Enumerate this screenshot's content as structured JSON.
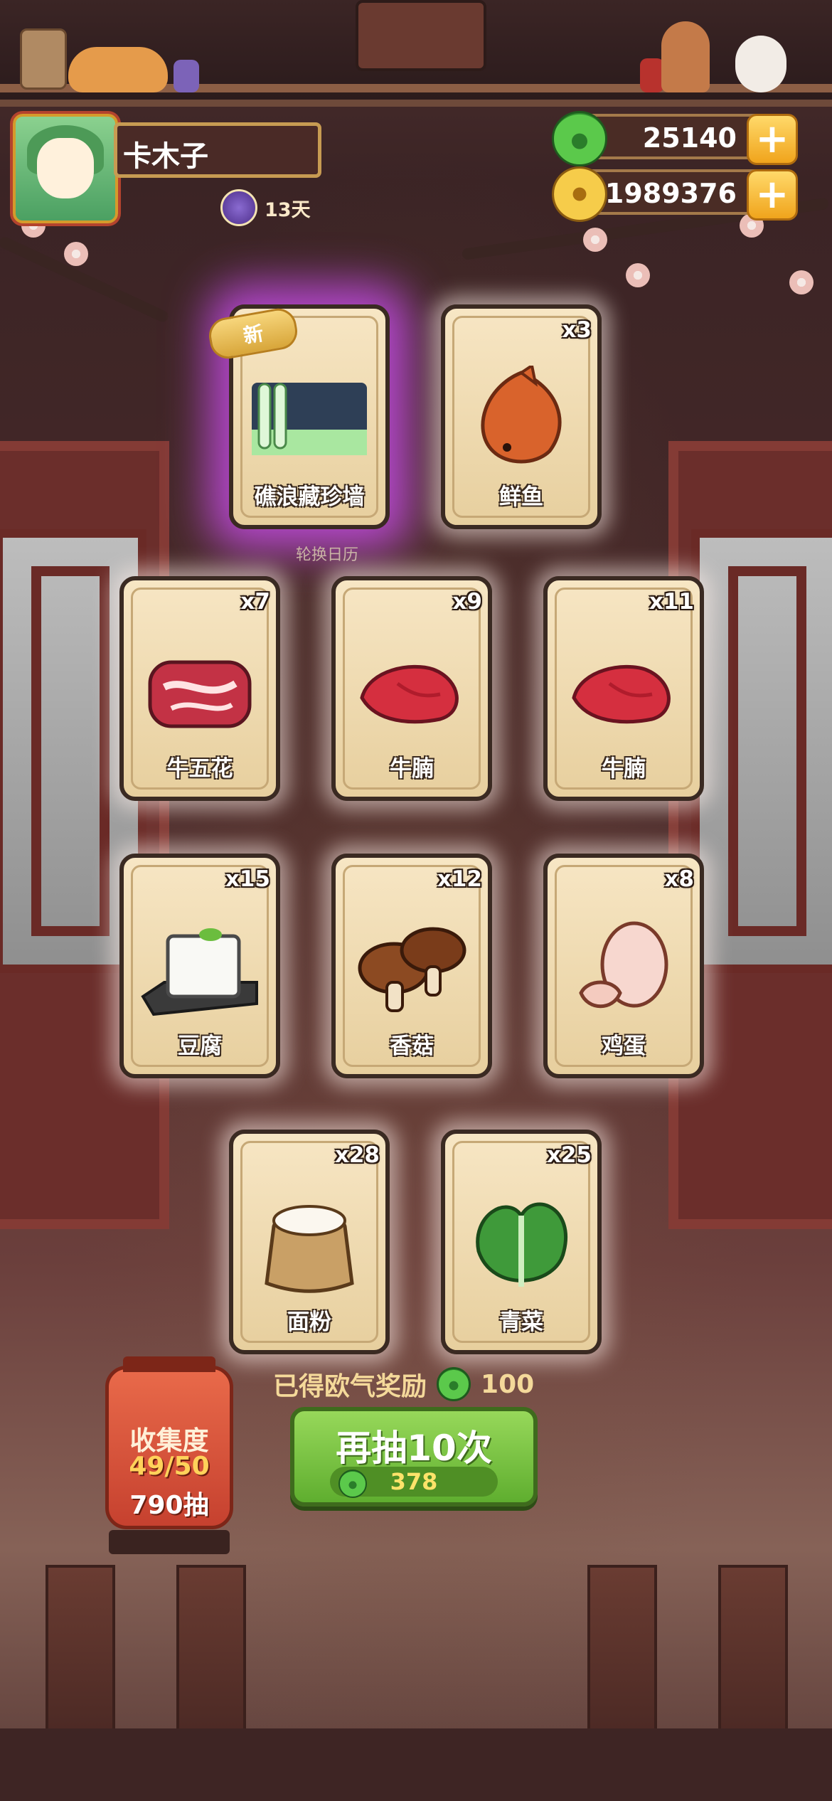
{
  "profile": {
    "name": "卡木子",
    "days": "13天"
  },
  "currency": {
    "jade": "25140",
    "coins": "1989376",
    "add_label": "+"
  },
  "banner": {
    "calendar_label": "轮换日历"
  },
  "cards": [
    {
      "name": "礁浪藏珍墙",
      "count": "",
      "is_new": true,
      "badge": "新",
      "icon": "wall-decor-icon"
    },
    {
      "name": "鲜鱼",
      "count": "x3",
      "icon": "fish-icon"
    },
    {
      "name": "牛五花",
      "count": "x7",
      "icon": "beef-belly-icon"
    },
    {
      "name": "牛腩",
      "count": "x9",
      "icon": "beef-brisket-icon"
    },
    {
      "name": "牛腩",
      "count": "x11",
      "icon": "beef-brisket-icon"
    },
    {
      "name": "豆腐",
      "count": "x15",
      "icon": "tofu-icon"
    },
    {
      "name": "香菇",
      "count": "x12",
      "icon": "mushroom-icon"
    },
    {
      "name": "鸡蛋",
      "count": "x8",
      "icon": "egg-icon"
    },
    {
      "name": "面粉",
      "count": "x28",
      "icon": "flour-icon"
    },
    {
      "name": "青菜",
      "count": "x25",
      "icon": "greens-icon"
    }
  ],
  "reward": {
    "label": "已得欧气奖励",
    "value": "100"
  },
  "collection": {
    "title": "收集度",
    "progress": "49/50",
    "pulls": "790抽"
  },
  "draw": {
    "label": "再抽10次",
    "cost": "378"
  },
  "colors": {
    "accent_green": "#5fae2f",
    "gold": "#f0a41c",
    "new_glow": "#d650ff"
  }
}
